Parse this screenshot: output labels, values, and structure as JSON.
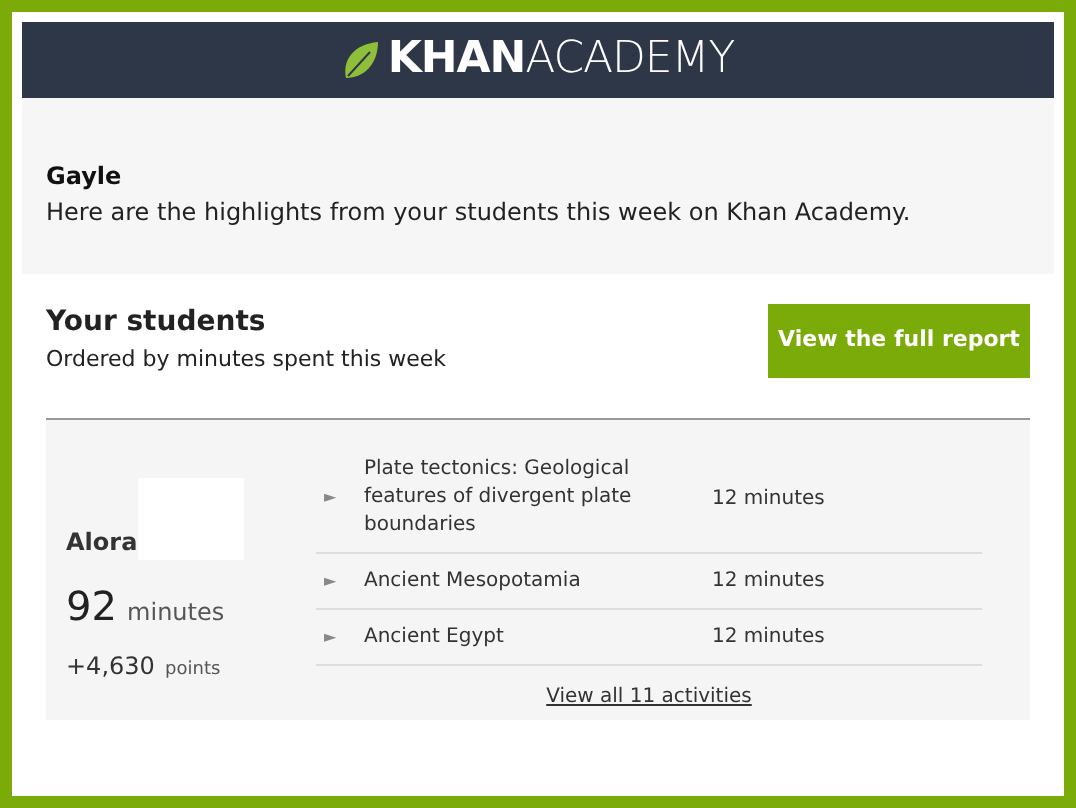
{
  "header": {
    "logo": {
      "bold": "KHAN",
      "light": "ACADEMY"
    }
  },
  "greeting": {
    "name": "Gayle",
    "message": "Here are the highlights from your students this week on Khan Academy."
  },
  "students_section": {
    "title": "Your students",
    "subtitle": "Ordered by minutes spent this week",
    "button": "View the full report"
  },
  "student": {
    "name": "Alora",
    "minutes": "92",
    "minutes_unit": "minutes",
    "points": "+4,630",
    "points_unit": "points",
    "activities": [
      {
        "marker": "►",
        "title": "Plate tectonics: Geological features of divergent plate boundaries",
        "time": "12 minutes"
      },
      {
        "marker": "►",
        "title": "Ancient Mesopotamia",
        "time": "12 minutes"
      },
      {
        "marker": "►",
        "title": "Ancient Egypt",
        "time": "12 minutes"
      }
    ],
    "view_all": "View all 11 activities"
  }
}
